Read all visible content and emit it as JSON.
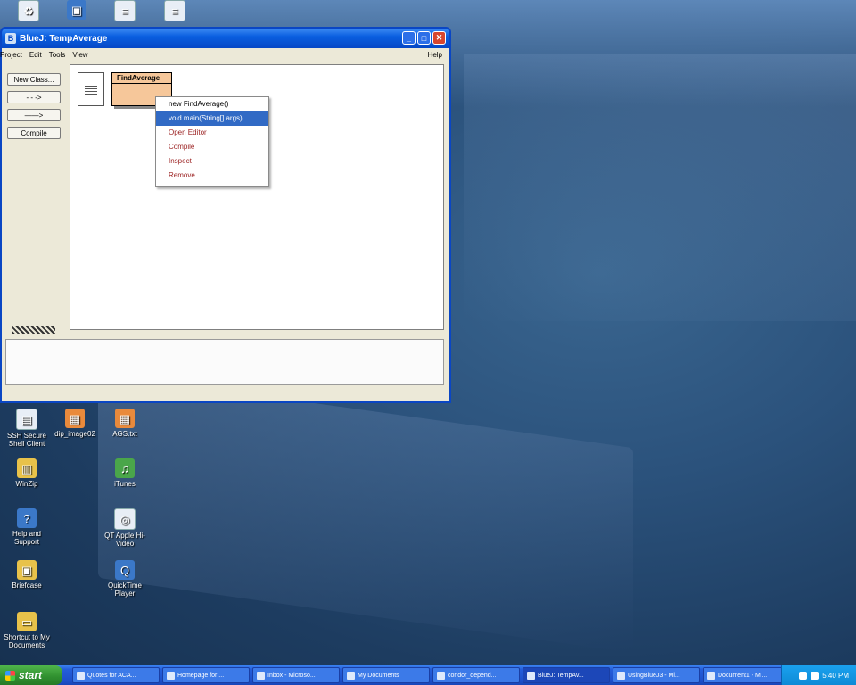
{
  "window": {
    "title": "BlueJ:  TempAverage",
    "menus": [
      "Project",
      "Edit",
      "Tools",
      "View"
    ],
    "help": "Help",
    "buttons": {
      "new_class": "New Class...",
      "dashed_arrow": "- - ->",
      "solid_arrow": "——>",
      "compile": "Compile"
    },
    "class_name": "FindAverage",
    "context_menu": [
      "new FindAverage()",
      "void main(String[] args)",
      "Open Editor",
      "Compile",
      "Inspect",
      "Remove"
    ],
    "selected_menu_index": 1
  },
  "desktop_icons": [
    {
      "label": "SSH Secure Shell Client",
      "icon": "monitor-icon"
    },
    {
      "label": "dip_image02",
      "icon": "image-icon"
    },
    {
      "label": "AGS.txt",
      "icon": "image-icon"
    },
    {
      "label": "WinZip",
      "icon": "winzip-icon"
    },
    {
      "label": "iTunes",
      "icon": "itunes-icon"
    },
    {
      "label": "Help and Support",
      "icon": "help-icon"
    },
    {
      "label": "QT Apple Hi-Video",
      "icon": "quicktime-icon"
    },
    {
      "label": "Briefcase",
      "icon": "briefcase-icon"
    },
    {
      "label": "QuickTime Player",
      "icon": "quicktime-icon"
    },
    {
      "label": "Shortcut to My Documents",
      "icon": "folder-icon"
    }
  ],
  "taskbar": {
    "start": "start",
    "tasks": [
      "Quotes for ACA...",
      "Homepage for ...",
      "Inbox - Microso...",
      "My Documents",
      "condor_depend...",
      "BlueJ: TempAv...",
      "UsingBlueJ3 - Mi...",
      "Document1 - Mi..."
    ],
    "active_task_index": 5,
    "clock": "5:40 PM"
  }
}
